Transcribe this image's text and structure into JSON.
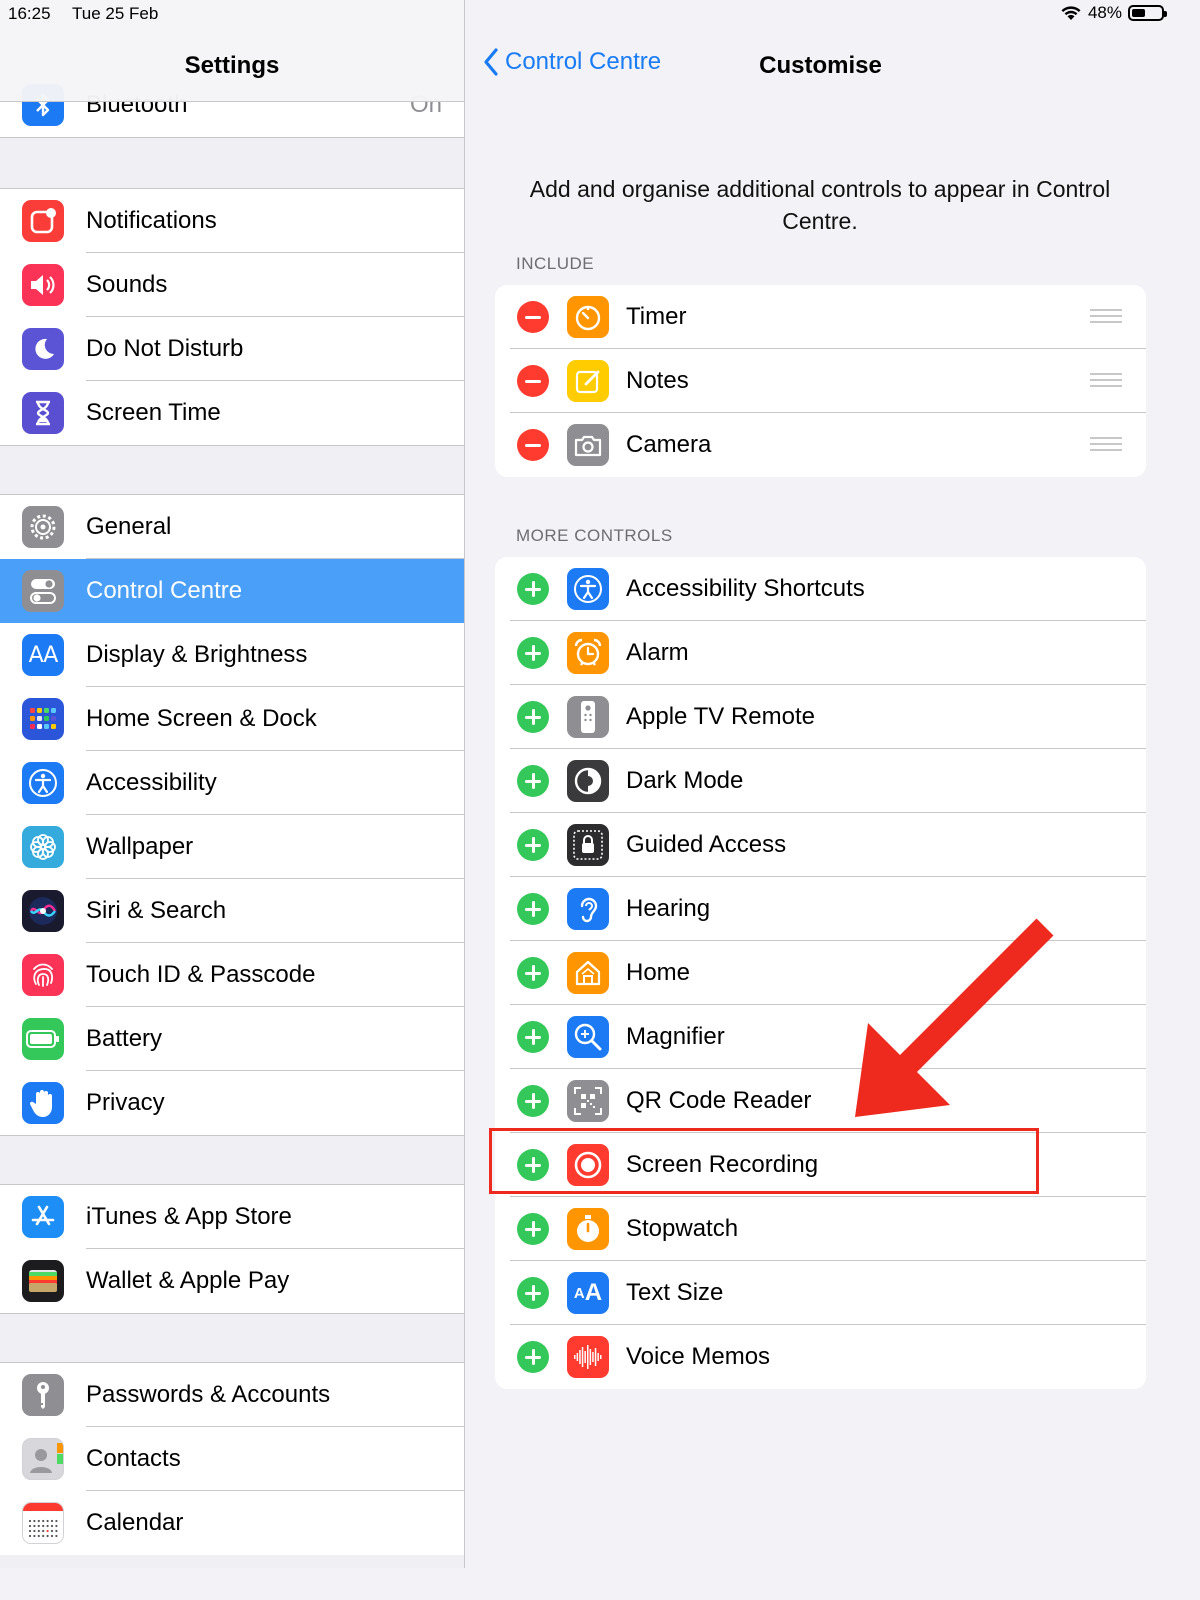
{
  "status": {
    "time": "16:25",
    "date": "Tue 25 Feb",
    "battery_text": "48%",
    "battery_level": 0.48
  },
  "left": {
    "title": "Settings",
    "bluetooth": {
      "label": "Bluetooth",
      "value": "On"
    },
    "group1": [
      {
        "label": "Notifications",
        "icon": "notifications-icon",
        "color": "#fb3d3a"
      },
      {
        "label": "Sounds",
        "icon": "sounds-icon",
        "color": "#fb3457"
      },
      {
        "label": "Do Not Disturb",
        "icon": "moon-icon",
        "color": "#5b55d6"
      },
      {
        "label": "Screen Time",
        "icon": "hourglass-icon",
        "color": "#5a4fd1"
      }
    ],
    "group2": [
      {
        "label": "General",
        "icon": "gear-icon",
        "color": "#8e8e93"
      },
      {
        "label": "Control Centre",
        "icon": "toggles-icon",
        "color": "#8e8e93",
        "selected": true
      },
      {
        "label": "Display & Brightness",
        "icon": "display-aa-icon",
        "color": "#1c7af4"
      },
      {
        "label": "Home Screen & Dock",
        "icon": "app-grid-icon",
        "color": "#2b56d9"
      },
      {
        "label": "Accessibility",
        "icon": "accessibility-icon",
        "color": "#1c7af4"
      },
      {
        "label": "Wallpaper",
        "icon": "flower-icon",
        "color": "#35aadc"
      },
      {
        "label": "Siri & Search",
        "icon": "siri-icon",
        "color": "#1a1a2e"
      },
      {
        "label": "Touch ID & Passcode",
        "icon": "fingerprint-icon",
        "color": "#fb3457"
      },
      {
        "label": "Battery",
        "icon": "battery-icon",
        "color": "#34c759"
      },
      {
        "label": "Privacy",
        "icon": "hand-icon",
        "color": "#1c7af4"
      }
    ],
    "group3": [
      {
        "label": "iTunes & App Store",
        "icon": "app-store-icon",
        "color": "#1c8ef5"
      },
      {
        "label": "Wallet & Apple Pay",
        "icon": "wallet-icon",
        "color": "#1c1c1e"
      }
    ],
    "group4": [
      {
        "label": "Passwords & Accounts",
        "icon": "key-icon",
        "color": "#8e8e93"
      },
      {
        "label": "Contacts",
        "icon": "contacts-icon",
        "color": "#c9c9ce"
      },
      {
        "label": "Calendar",
        "icon": "calendar-icon",
        "color": "#ffffff"
      }
    ]
  },
  "right": {
    "back_label": "Control Centre",
    "title": "Customise",
    "intro": "Add and organise additional controls to appear in Control Centre.",
    "include_header": "INCLUDE",
    "more_header": "MORE CONTROLS",
    "include": [
      {
        "label": "Timer",
        "icon": "timer-icon",
        "color": "#ff9500"
      },
      {
        "label": "Notes",
        "icon": "notes-icon",
        "color": "#ffcc00"
      },
      {
        "label": "Camera",
        "icon": "camera-icon",
        "color": "#8e8e93"
      }
    ],
    "more": [
      {
        "label": "Accessibility Shortcuts",
        "icon": "accessibility-icon",
        "color": "#1c7af4"
      },
      {
        "label": "Alarm",
        "icon": "alarm-icon",
        "color": "#ff9500"
      },
      {
        "label": "Apple TV Remote",
        "icon": "remote-icon",
        "color": "#8e8e93"
      },
      {
        "label": "Dark Mode",
        "icon": "dark-mode-icon",
        "color": "#3a3a3c"
      },
      {
        "label": "Guided Access",
        "icon": "lock-icon",
        "color": "#2c2c2e"
      },
      {
        "label": "Hearing",
        "icon": "ear-icon",
        "color": "#1c7af4"
      },
      {
        "label": "Home",
        "icon": "home-icon",
        "color": "#ff9500"
      },
      {
        "label": "Magnifier",
        "icon": "magnifier-icon",
        "color": "#1c7af4"
      },
      {
        "label": "QR Code Reader",
        "icon": "qr-code-icon",
        "color": "#8e8e93"
      },
      {
        "label": "Screen Recording",
        "icon": "record-icon",
        "color": "#ff3b30",
        "highlighted": true
      },
      {
        "label": "Stopwatch",
        "icon": "stopwatch-icon",
        "color": "#ff9500"
      },
      {
        "label": "Text Size",
        "icon": "text-size-icon",
        "color": "#1c7af4"
      },
      {
        "label": "Voice Memos",
        "icon": "voice-memos-icon",
        "color": "#ff3b30"
      }
    ]
  },
  "annotation": {
    "highlight_color": "#ee2a1e"
  }
}
